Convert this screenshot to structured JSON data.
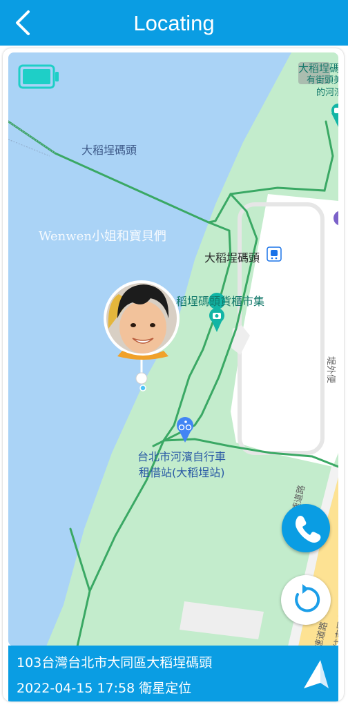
{
  "header": {
    "title": "Locating",
    "back_icon": "chevron-left-icon"
  },
  "map": {
    "labels": {
      "wharf_water": "大稻埕碼頭",
      "wharf_station": "大稻埕碼頭",
      "market": "稻埕碼頭貨櫃市集",
      "bike_station_line1": "台北市河濱自行車",
      "bike_station_line2": "租借站(大稻埕站)",
      "corner_line1": "大稻埕碼",
      "corner_line2": "有街頭美",
      "corner_line3": "的河濱",
      "road_line1": "環河快速道路",
      "road_line2": "堤外便",
      "road_line3": "速道路",
      "road_line4": "往市民大道出口匝道"
    },
    "watermark": "Wenwen小姐和寶貝們",
    "colors": {
      "water": "#aad3f6",
      "park": "#c3eccc",
      "path": "#3aa864",
      "road": "#ffffff",
      "highway": "#fde293"
    }
  },
  "device": {
    "battery_icon": "battery-full-icon",
    "avatar_icon": "child-avatar-icon"
  },
  "actions": {
    "call_icon": "phone-icon",
    "refresh_icon": "refresh-icon",
    "navigate_icon": "navigation-arrow-icon"
  },
  "status": {
    "address": "103台灣台北市大同區大稻埕碼頭",
    "timestamp": "2022-04-15 17:58 衛星定位"
  }
}
